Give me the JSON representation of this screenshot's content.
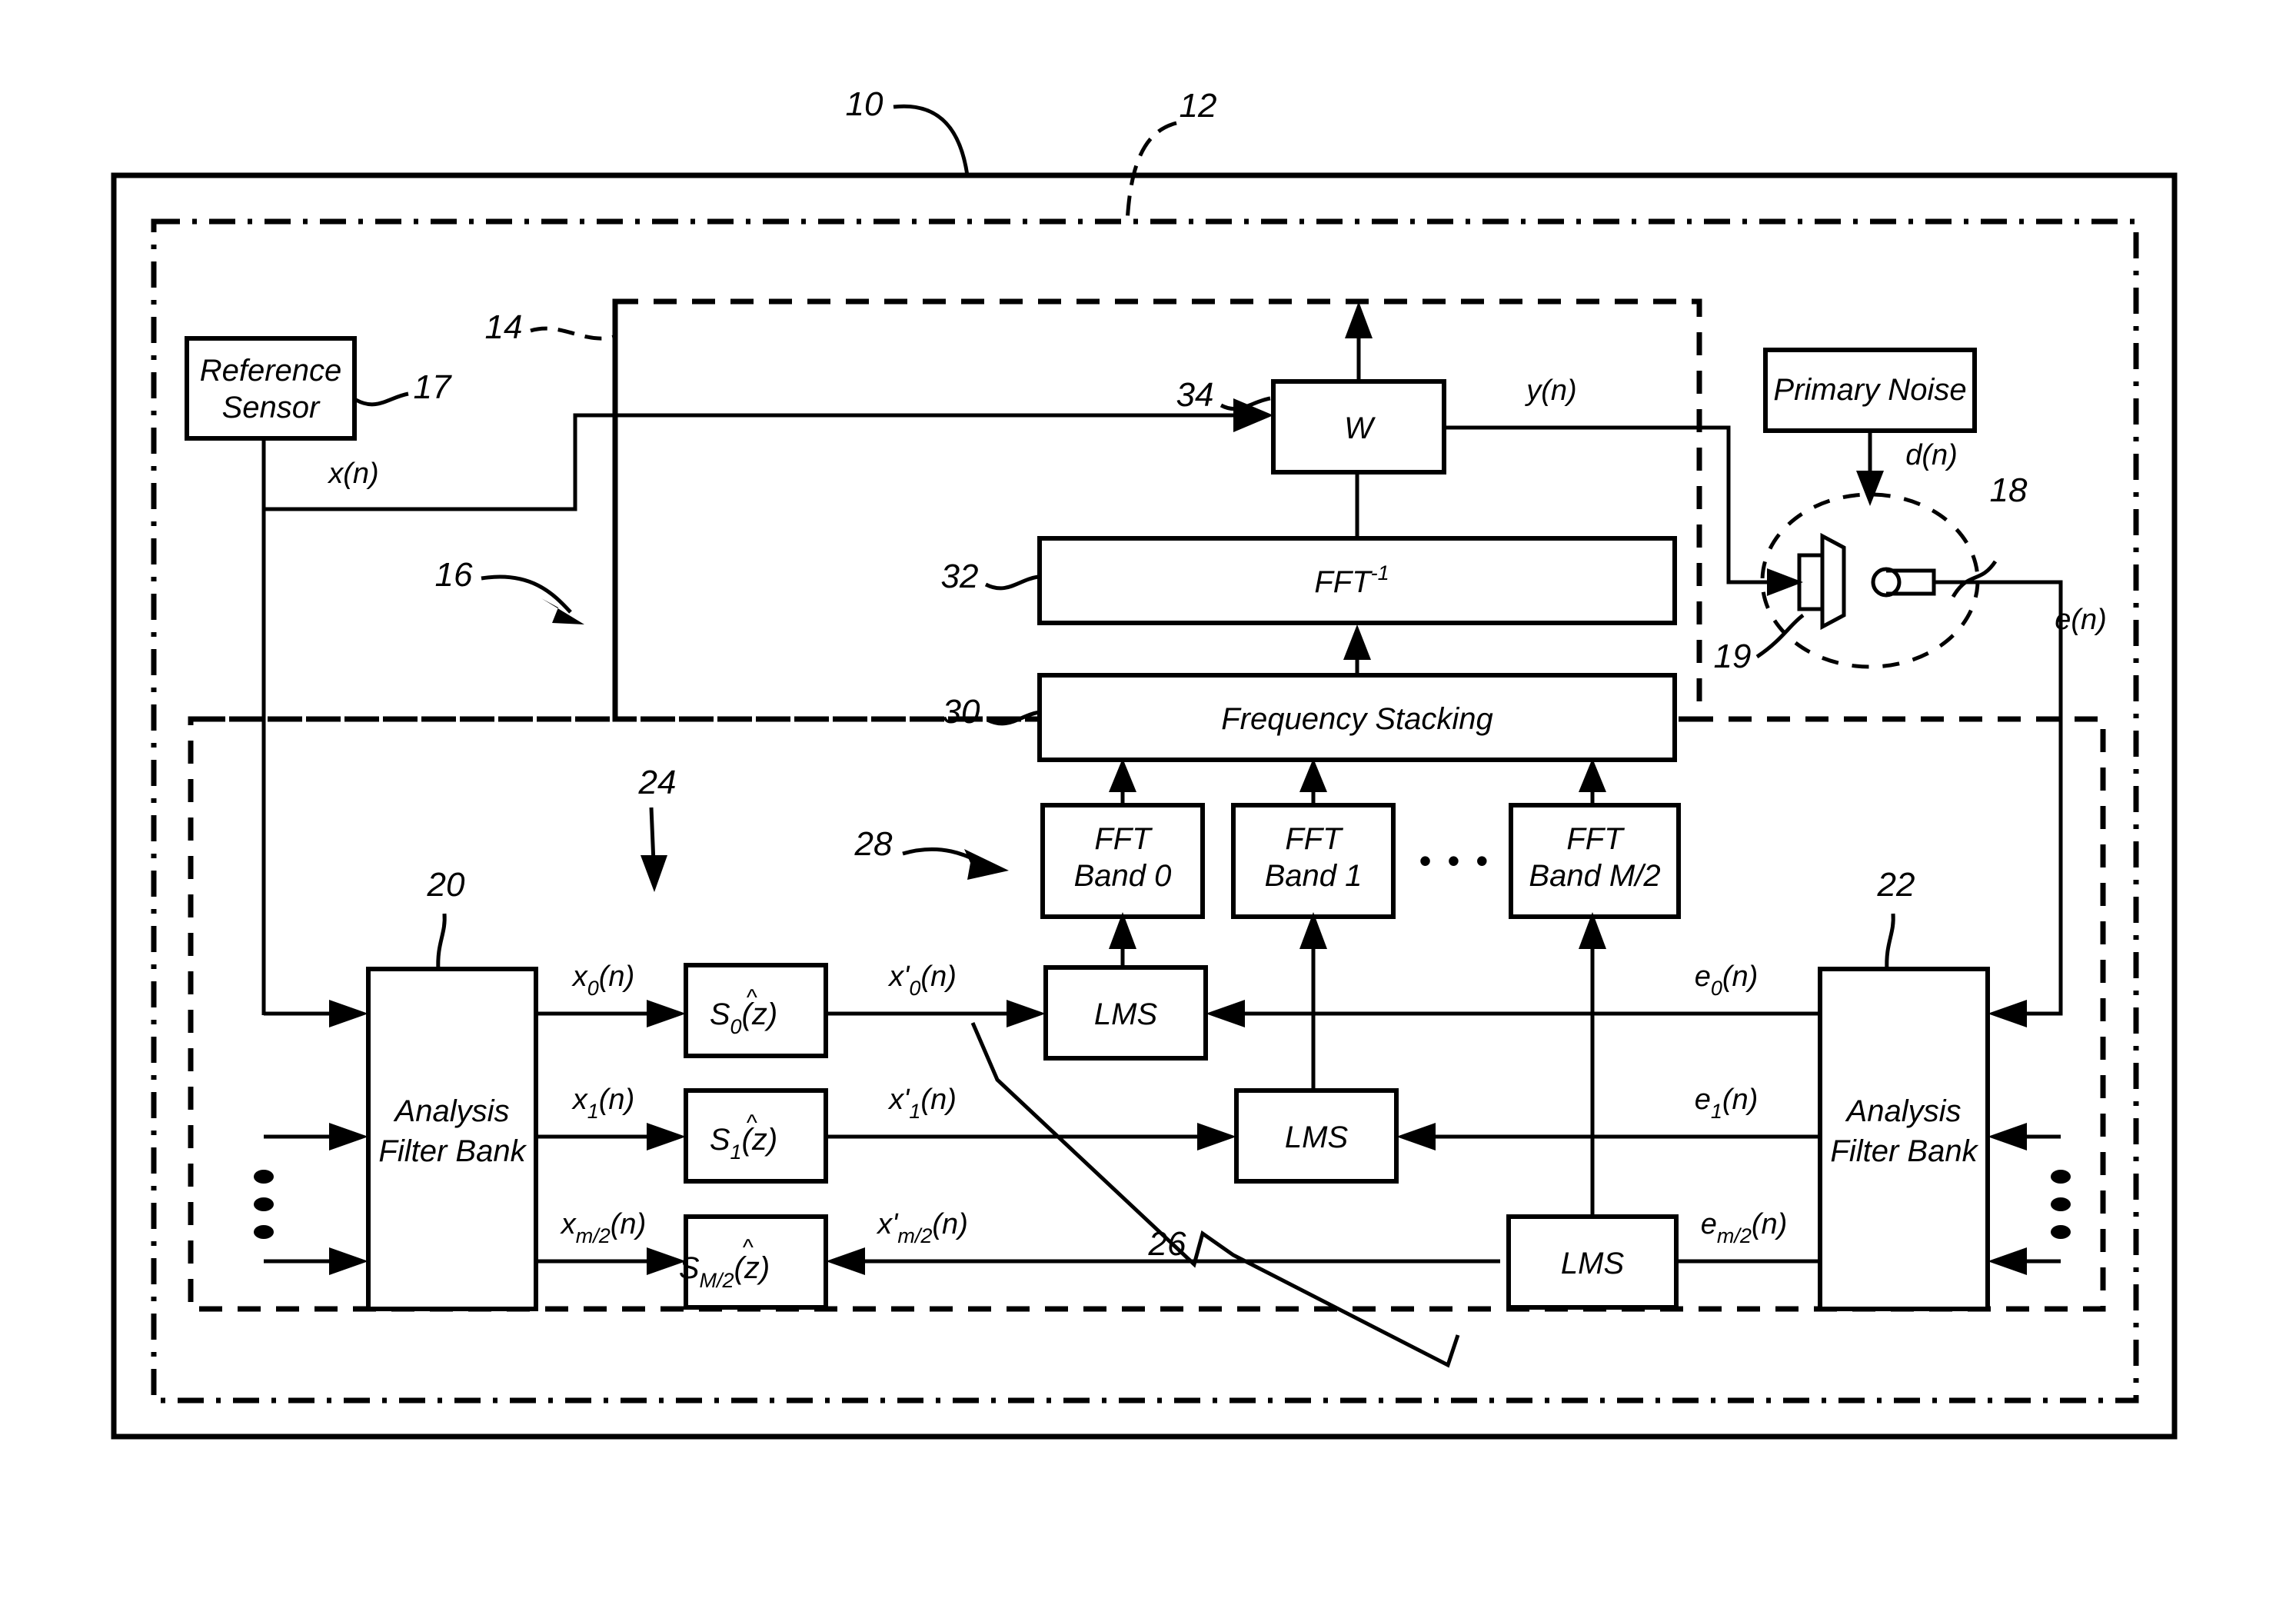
{
  "figure": {
    "kind": "patent-block-diagram",
    "description": "Subband adaptive active noise control system block diagram"
  },
  "reference_numerals": {
    "outer_system": "10",
    "dashdot_enclosure": "12",
    "upper_dashed_enclosure": "14",
    "left_dashed_enclosure": "16",
    "reference_sensor": "17",
    "error_microphone": "18",
    "loudspeaker": "19",
    "analysis_filter_bank_left": "20",
    "analysis_filter_bank_right": "22",
    "secondary_path_estimate_group": "24",
    "lms_group": "26",
    "fft_band_group": "28",
    "frequency_stacking": "30",
    "inverse_fft": "32",
    "adaptive_filter_w": "34"
  },
  "blocks": {
    "reference_sensor": {
      "line1": "Reference",
      "line2": "Sensor"
    },
    "primary_noise": {
      "label": "Primary Noise"
    },
    "w": {
      "label": "W"
    },
    "inverse_fft": {
      "label": "FFT",
      "exponent": "-1"
    },
    "frequency_stacking": {
      "label": "Frequency Stacking"
    },
    "fft_bands": [
      {
        "line1": "FFT",
        "line2": "Band 0"
      },
      {
        "line1": "FFT",
        "line2": "Band 1"
      },
      {
        "line1": "FFT",
        "line2": "Band M/2"
      }
    ],
    "fft_band_ellipsis": "• • •",
    "analysis_filter_bank_left": {
      "line1": "Analysis",
      "line2": "Filter Bank"
    },
    "analysis_filter_bank_right": {
      "line1": "Analysis",
      "line2": "Filter Bank"
    },
    "secondary_path_filters": [
      {
        "base": "S",
        "sub": "0",
        "arg": "(z)"
      },
      {
        "base": "S",
        "sub": "1",
        "arg": "(z)"
      },
      {
        "base": "S",
        "sub": "M/2",
        "arg": "(z)"
      }
    ],
    "lms_blocks": [
      {
        "label": "LMS"
      },
      {
        "label": "LMS"
      },
      {
        "label": "LMS"
      }
    ]
  },
  "signals": {
    "reference_input": "x(n)",
    "anti_noise_output": "y(n)",
    "primary_noise_path": "d(n)",
    "error_signal": "e(n)",
    "subband_reference": [
      {
        "base": "x",
        "sub": "0",
        "arg": "(n)"
      },
      {
        "base": "x",
        "sub": "1",
        "arg": "(n)"
      },
      {
        "base": "x",
        "sub": "m/2",
        "arg": "(n)"
      }
    ],
    "filtered_reference": [
      {
        "base": "x'",
        "sub": "0",
        "arg": "(n)"
      },
      {
        "base": "x'",
        "sub": "1",
        "arg": "(n)"
      },
      {
        "base": "x'",
        "sub": "m/2",
        "arg": "(n)"
      }
    ],
    "subband_error": [
      {
        "base": "e",
        "sub": "0",
        "arg": "(n)"
      },
      {
        "base": "e",
        "sub": "1",
        "arg": "(n)"
      },
      {
        "base": "e",
        "sub": "m/2",
        "arg": "(n)"
      }
    ]
  },
  "colors": {
    "line": "#000000",
    "background": "#ffffff",
    "box_fill": "#ffffff"
  }
}
